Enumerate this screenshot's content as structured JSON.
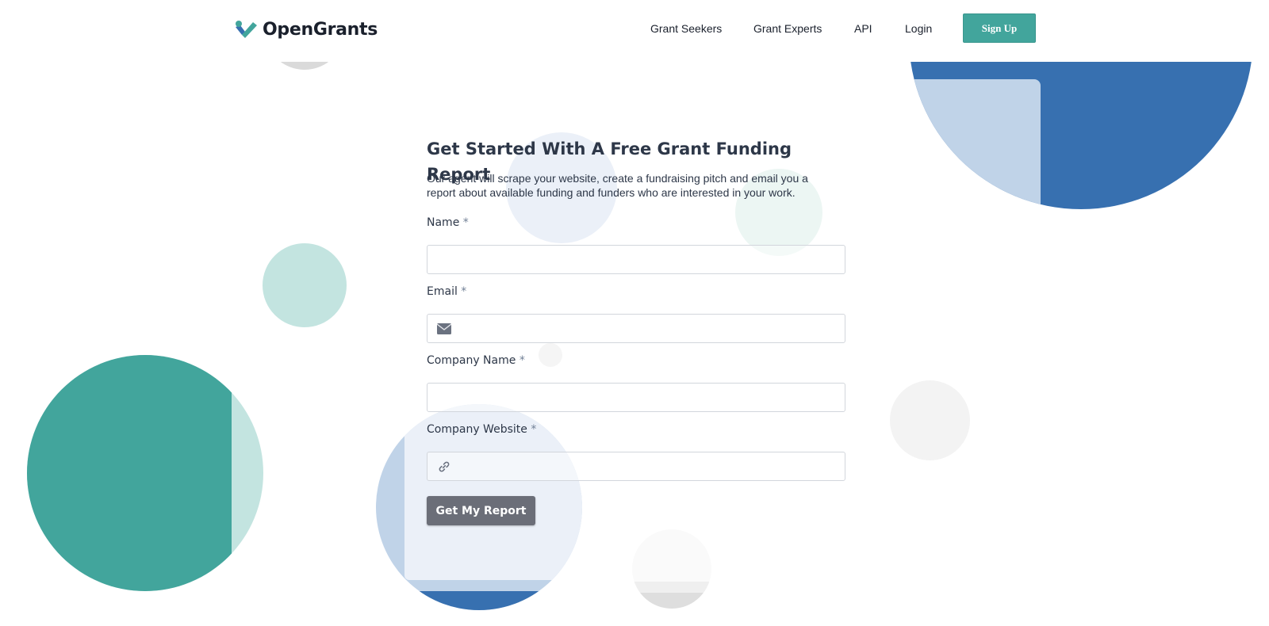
{
  "brand": {
    "name": "OpenGrants"
  },
  "nav": {
    "items": [
      {
        "label": "Grant Seekers"
      },
      {
        "label": "Grant Experts"
      },
      {
        "label": "API"
      },
      {
        "label": "Login"
      }
    ],
    "signup_label": "Sign Up"
  },
  "form": {
    "title": "Get Started With A Free Grant Funding Report",
    "description": "Our agent will scrape your website, create a fundraising pitch and email you a report about available funding and funders who are interested in your work.",
    "fields": [
      {
        "label": "Name",
        "required_mark": "*",
        "value": "",
        "icon": ""
      },
      {
        "label": "Email",
        "required_mark": "*",
        "value": "",
        "icon": "envelope-icon"
      },
      {
        "label": "Company Name",
        "required_mark": "*",
        "value": "",
        "icon": ""
      },
      {
        "label": "Company Website",
        "required_mark": "*",
        "value": "",
        "icon": "link-icon"
      }
    ],
    "submit_label": "Get My Report"
  },
  "colors": {
    "teal": "#42a59c",
    "teal_light": "#c3e4e0",
    "blue": "#3770b0",
    "blue_light": "#c0d3e8",
    "button_gray": "#6b6e78"
  }
}
